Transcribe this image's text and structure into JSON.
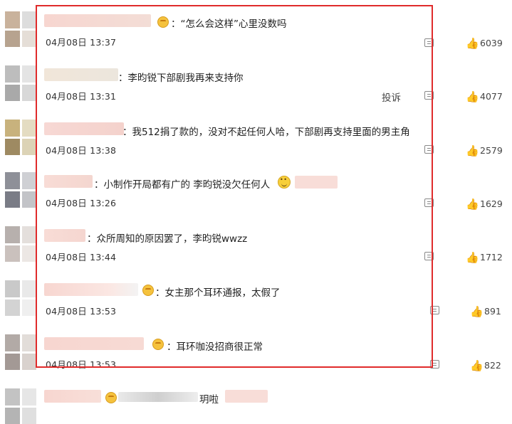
{
  "comments": [
    {
      "text": "：“怎么会这样”心里没数吗",
      "date": "04月08日 13:37",
      "likes": "6039"
    },
    {
      "text": "：李昀锐下部剧我再来支持你",
      "date": "04月08日 13:31",
      "likes": "4077"
    },
    {
      "text": "：我512捐了款的，没对不起任何人哈，下部剧再支持里面的男主角",
      "date": "04月08日 13:38",
      "likes": "2579"
    },
    {
      "text": "：小制作开局都有广的 李昀锐没欠任何人",
      "date": "04月08日 13:26",
      "likes": "1629"
    },
    {
      "text": "：众所周知的原因罢了，李昀锐wwzz",
      "date": "04月08日 13:44",
      "likes": "1712"
    },
    {
      "text": "：女主那个耳环通报，太假了",
      "date": "04月08日 13:53",
      "likes": "891"
    },
    {
      "text": "：耳环咖没招商很正常",
      "date": "04月08日 13:53",
      "likes": "822"
    },
    {
      "text": "玥啦",
      "date": "",
      "likes": ""
    }
  ],
  "report_label": "投诉",
  "icons": {
    "like": "thumbs-up-icon",
    "reply": "reply-icon",
    "badge": "crown-badge-icon",
    "emoji": "smile-emoji-icon"
  },
  "colors": {
    "highlight_frame": "#e02b2b"
  }
}
